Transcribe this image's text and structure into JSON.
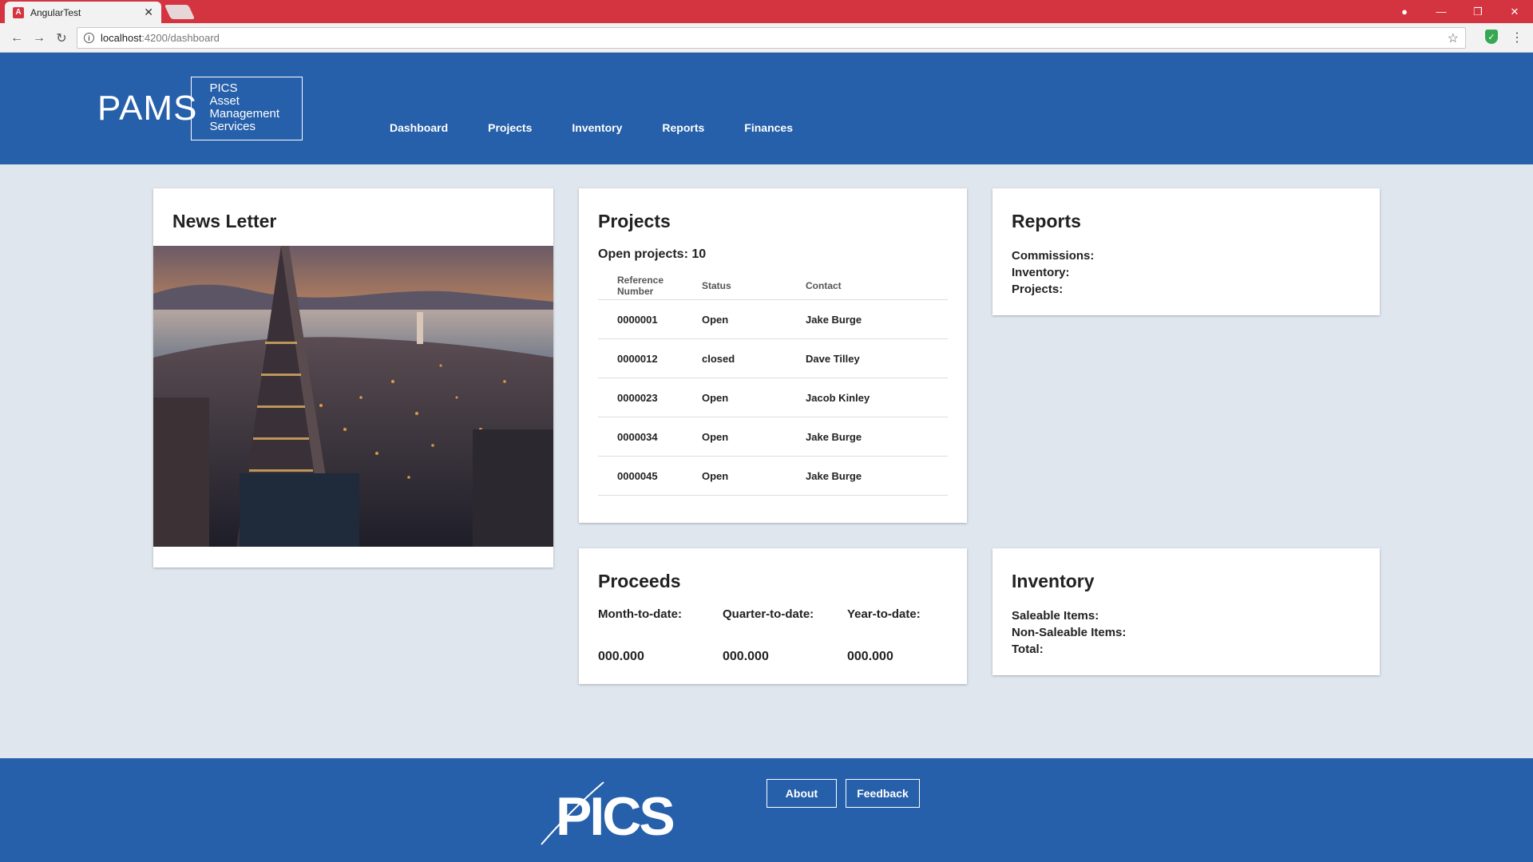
{
  "browser": {
    "tab_title": "AngularTest",
    "url_host": "localhost",
    "url_path": ":4200/dashboard"
  },
  "header": {
    "logo_main": "PAMS",
    "logo_sub": [
      "PICS",
      "Asset",
      "Management",
      "Services"
    ],
    "nav": [
      "Dashboard",
      "Projects",
      "Inventory",
      "Reports",
      "Finances"
    ]
  },
  "newsletter": {
    "title": "News Letter"
  },
  "projects": {
    "title": "Projects",
    "open_label": "Open projects: 10",
    "columns": [
      "Reference Number",
      "Status",
      "Contact"
    ],
    "rows": [
      [
        "0000001",
        "Open",
        "Jake Burge"
      ],
      [
        "0000012",
        "closed",
        "Dave Tilley"
      ],
      [
        "0000023",
        "Open",
        "Jacob Kinley"
      ],
      [
        "0000034",
        "Open",
        "Jake Burge"
      ],
      [
        "0000045",
        "Open",
        "Jake Burge"
      ]
    ]
  },
  "reports": {
    "title": "Reports",
    "lines": [
      "Commissions:",
      "Inventory:",
      "Projects:"
    ]
  },
  "proceeds": {
    "title": "Proceeds",
    "columns": [
      {
        "label": "Month-to-date:",
        "value": "000.000"
      },
      {
        "label": "Quarter-to-date:",
        "value": "000.000"
      },
      {
        "label": "Year-to-date:",
        "value": "000.000"
      }
    ]
  },
  "inventory": {
    "title": "Inventory",
    "lines": [
      "Saleable Items:",
      "Non-Saleable Items:",
      "Total:"
    ]
  },
  "footer": {
    "logo_text": "PICS",
    "about": "About",
    "feedback": "Feedback"
  },
  "colors": {
    "brand_blue": "#265faa",
    "chrome_red": "#d4343f",
    "page_bg": "#dfe6ee"
  }
}
